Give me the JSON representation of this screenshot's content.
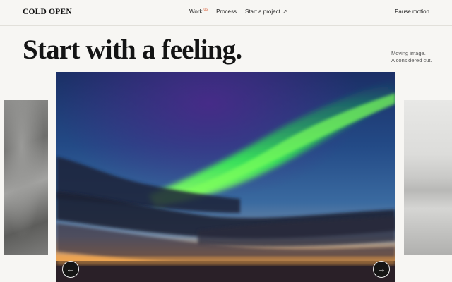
{
  "header": {
    "brand": "COLD OPEN",
    "nav": [
      {
        "label": "Work",
        "count": "06"
      },
      {
        "label": "Process"
      },
      {
        "label": "Start a project",
        "icon": "arrow-up-right-icon"
      }
    ],
    "pause_label": "Pause motion"
  },
  "hero": {
    "headline": "Start with a feeling.",
    "tagline_line1": "Moving image.",
    "tagline_line2": "A considered cut."
  },
  "carousel": {
    "prev_glyph": "←",
    "next_glyph": "→",
    "slides": [
      "aurora-over-sunset",
      "grey-rock-texture",
      "frozen-shoreline"
    ]
  },
  "colors": {
    "background": "#f7f6f3",
    "accent": "#d9542b",
    "text": "#1a1a1a"
  }
}
